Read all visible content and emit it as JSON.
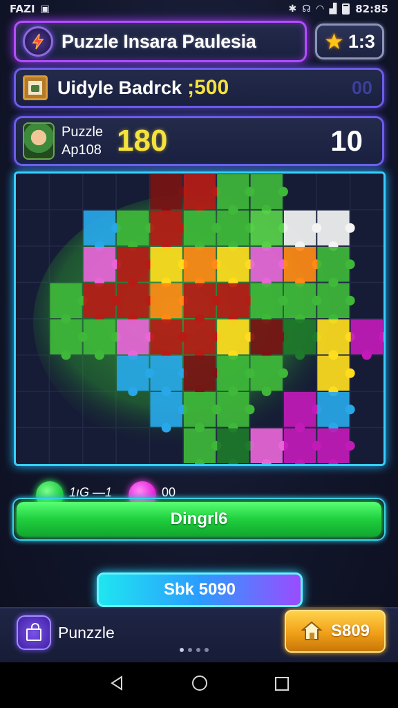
{
  "status_bar": {
    "left_text": "FAZI",
    "time": "82:85"
  },
  "header": {
    "title": "Puzzle Insara Paulesia",
    "stars": "1:3"
  },
  "level": {
    "label": "Uidyle Badrck",
    "score": ";500",
    "right": "00"
  },
  "score_panel": {
    "label_line1": "Puzzle",
    "label_line2": "Ap108",
    "score": "180",
    "right": "10"
  },
  "progress": {
    "label_a": "1ıG —1",
    "label_b": "00"
  },
  "buttons": {
    "primary": "Dingrl6",
    "secondary": "Sbk 5090"
  },
  "bottom_bar": {
    "label": "Punzzle",
    "gold_button": "S809"
  },
  "board": {
    "cols": 11,
    "rows": 8
  },
  "colors": {
    "accent": "#b64cff",
    "board_border": "#35d0ff",
    "score": "#f5e23c",
    "primary_btn": "#1fcf3e"
  }
}
